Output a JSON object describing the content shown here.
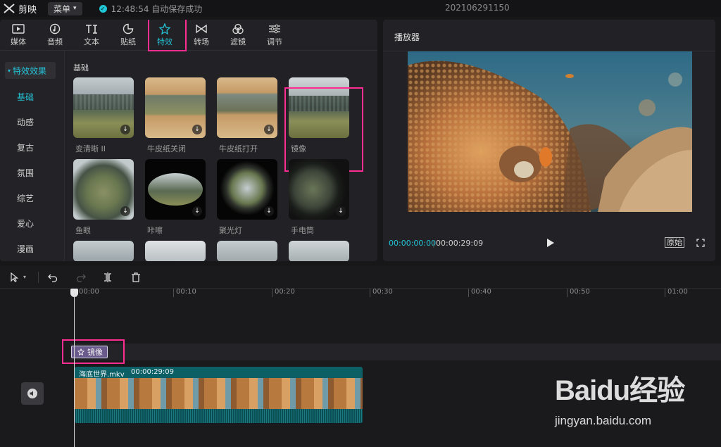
{
  "app": {
    "name": "剪映",
    "menu_label": "菜单",
    "save_status": "12:48:54 自动保存成功",
    "project_name": "202106291150"
  },
  "tabs": [
    {
      "label": "媒体",
      "icon": "media-icon"
    },
    {
      "label": "音频",
      "icon": "audio-icon"
    },
    {
      "label": "文本",
      "icon": "text-icon"
    },
    {
      "label": "贴纸",
      "icon": "sticker-icon"
    },
    {
      "label": "特效",
      "icon": "effects-icon",
      "active": true
    },
    {
      "label": "转场",
      "icon": "transition-icon"
    },
    {
      "label": "滤镜",
      "icon": "filter-icon"
    },
    {
      "label": "调节",
      "icon": "adjust-icon"
    }
  ],
  "sidebar": {
    "header": "特效效果",
    "items": [
      "基础",
      "动感",
      "复古",
      "氛围",
      "综艺",
      "爱心",
      "漫画"
    ]
  },
  "effects": {
    "section_title": "基础",
    "cards": [
      {
        "label": "变清晰 II"
      },
      {
        "label": "牛皮纸关闭"
      },
      {
        "label": "牛皮纸打开"
      },
      {
        "label": "镜像"
      },
      {
        "label": "鱼眼"
      },
      {
        "label": "咔嚓"
      },
      {
        "label": "聚光灯"
      },
      {
        "label": "手电筒"
      }
    ]
  },
  "player": {
    "title": "播放器",
    "current_time": "00:00:00:00",
    "total_time": "00:00:29:09",
    "ratio_label": "原始"
  },
  "timeline": {
    "ruler_labels": [
      "00:00",
      "00:10",
      "00:20",
      "00:30",
      "00:40",
      "00:50",
      "01:00"
    ],
    "effect_clip_label": "镜像",
    "video_clip_name": "海底世界.mkv",
    "video_clip_duration": "00:00:29:09"
  },
  "watermark": {
    "brand": "Baidu经验",
    "url": "jingyan.baidu.com"
  },
  "colors": {
    "accent": "#24c2d6",
    "highlight": "#ff2d92",
    "clip": "#0d5f66",
    "effect_clip": "#6a5a8c"
  }
}
